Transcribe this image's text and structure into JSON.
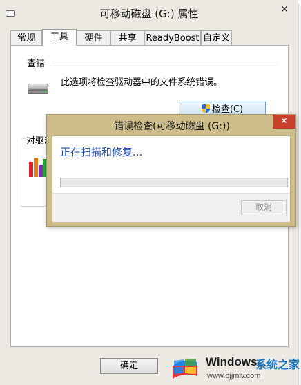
{
  "props_window": {
    "title": "可移动磁盘 (G:) 属性",
    "close_symbol": "✕",
    "tabs": [
      {
        "label": "常规"
      },
      {
        "label": "工具"
      },
      {
        "label": "硬件"
      },
      {
        "label": "共享"
      },
      {
        "label": "ReadyBoost"
      },
      {
        "label": "自定义"
      }
    ],
    "active_tab": "工具",
    "error_check": {
      "group_title": "查错",
      "description": "此选项将检查驱动器中的文件系统错误。",
      "button_label": "检查(C)",
      "button_icon": "uac-shield-icon"
    },
    "optimize": {
      "group_title": "对驱动",
      "icon": "defrag-icon"
    },
    "ok_button": "确定"
  },
  "dialog": {
    "title": "错误检查(可移动磁盘 (G:))",
    "close_symbol": "✕",
    "status": "正在扫描和修复...",
    "progress": 0,
    "cancel_button": "取消"
  },
  "watermark": {
    "brand": "Windows",
    "sub": "系统之家",
    "url": "www.bjjmlv.com"
  },
  "colors": {
    "dialog_frame": "#cdbd8a",
    "dialog_close": "#c7402b",
    "status_text": "#1f4fb0",
    "progress_fill": "#06b025"
  }
}
